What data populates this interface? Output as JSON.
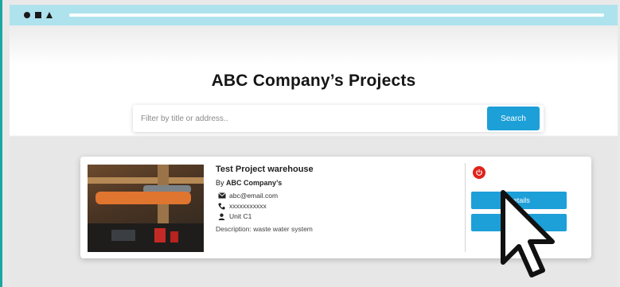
{
  "page": {
    "heading": "ABC Company’s Projects"
  },
  "search": {
    "placeholder": "Filter by title or address..",
    "button_label": "Search"
  },
  "project": {
    "title": "Test Project warehouse",
    "by_label": "By",
    "company": "ABC Company’s",
    "email": "abc@email.com",
    "phone": "xxxxxxxxxxx",
    "unit": "Unit C1",
    "description": "Description: waste water system",
    "details_button": "Details",
    "second_button": ""
  },
  "colors": {
    "accent": "#1d9fd8",
    "power": "#e0221a",
    "chrome": "#aee3ee",
    "edge": "#1aa7a0"
  },
  "icons": {
    "status": "power-icon",
    "email": "envelope-icon",
    "phone": "phone-icon",
    "unit": "person-icon",
    "pointer": "mouse-pointer-icon"
  }
}
